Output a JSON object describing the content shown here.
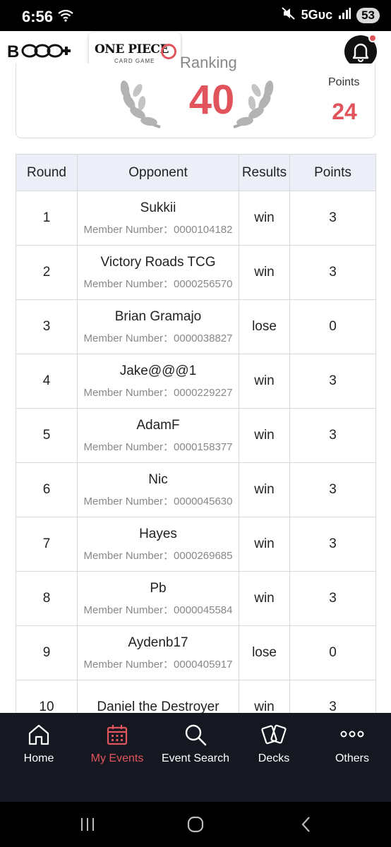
{
  "status_bar": {
    "time": "6:56",
    "network": "5Gᴜᴄ",
    "battery": "53"
  },
  "header": {
    "brand_logo": "B",
    "game_logo_title": "ONE PIECE",
    "game_logo_subtitle": "CARD GAME"
  },
  "ranking": {
    "label": "Ranking",
    "value": "40",
    "points_label": "Points",
    "points_value": "24"
  },
  "table": {
    "headers": [
      "Round",
      "Opponent",
      "Results",
      "Points"
    ],
    "member_prefix": "Member Number：",
    "rows": [
      {
        "round": "1",
        "opponent": "Sukkii",
        "member": "Member Number：0000104182",
        "result": "win",
        "points": "3"
      },
      {
        "round": "2",
        "opponent": "Victory Roads TCG",
        "member": "Member Number：0000256570",
        "result": "win",
        "points": "3"
      },
      {
        "round": "3",
        "opponent": "Brian Gramajo",
        "member": "Member Number：0000038827",
        "result": "lose",
        "points": "0"
      },
      {
        "round": "4",
        "opponent": "Jake@@@1",
        "member": "Member Number：0000229227",
        "result": "win",
        "points": "3"
      },
      {
        "round": "5",
        "opponent": "AdamF",
        "member": "Member Number：0000158377",
        "result": "win",
        "points": "3"
      },
      {
        "round": "6",
        "opponent": "Nic",
        "member": "Member Number：0000045630",
        "result": "win",
        "points": "3"
      },
      {
        "round": "7",
        "opponent": "Hayes",
        "member": "Member Number：0000269685",
        "result": "win",
        "points": "3"
      },
      {
        "round": "8",
        "opponent": "Pb",
        "member": "Member Number：0000045584",
        "result": "win",
        "points": "3"
      },
      {
        "round": "9",
        "opponent": "Aydenb17",
        "member": "Member Number：0000405917",
        "result": "lose",
        "points": "0"
      },
      {
        "round": "10",
        "opponent": "Daniel the Destroyer",
        "member": "",
        "result": "win",
        "points": "3"
      }
    ]
  },
  "bottom_nav": {
    "items": [
      {
        "label": "Home",
        "icon": "home-icon"
      },
      {
        "label": "My Events",
        "icon": "calendar-icon",
        "active": true
      },
      {
        "label": "Event Search",
        "icon": "search-icon"
      },
      {
        "label": "Decks",
        "icon": "cards-icon"
      },
      {
        "label": "Others",
        "icon": "more-icon"
      }
    ]
  },
  "colors": {
    "accent": "#e2545c",
    "nav_bg": "#151820",
    "table_header_bg": "#eceef8"
  }
}
